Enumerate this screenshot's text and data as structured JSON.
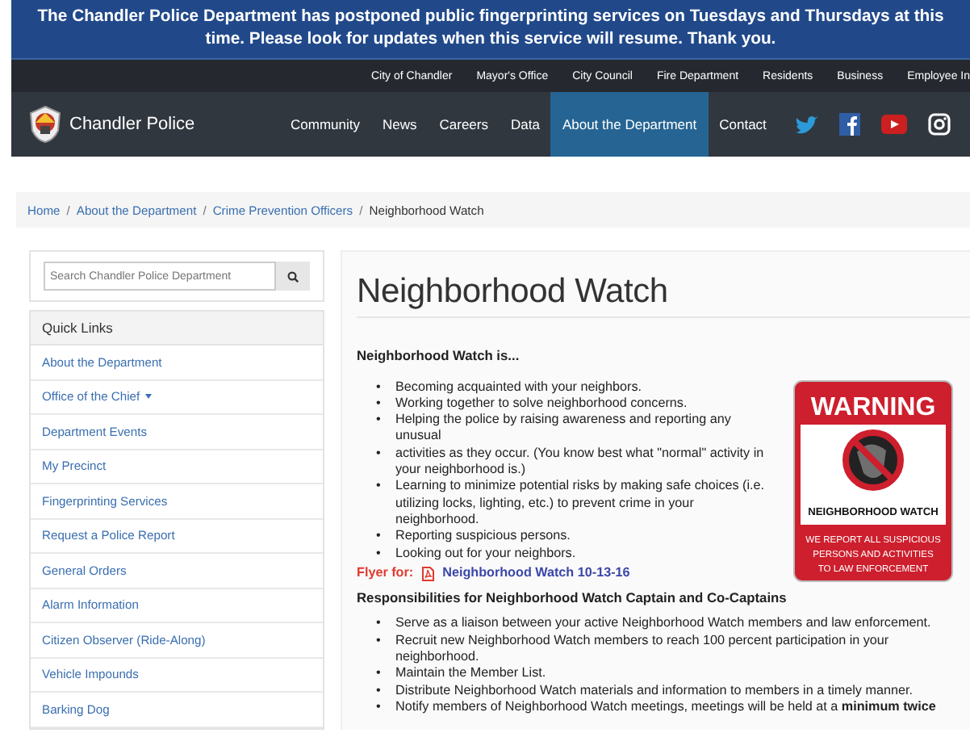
{
  "alert_banner": {
    "text": "The Chandler Police Department has postponed public fingerprinting services on Tuesdays and Thursdays at this time. Please look for updates when this service will resume. Thank you."
  },
  "utility_links": [
    "City of Chandler",
    "Mayor's Office",
    "City Council",
    "Fire Department",
    "Residents",
    "Business",
    "Employee In"
  ],
  "header": {
    "site_name": "Chandler Police",
    "nav": [
      {
        "label": "Community",
        "selected": false
      },
      {
        "label": "News",
        "selected": false
      },
      {
        "label": "Careers",
        "selected": false
      },
      {
        "label": "Data",
        "selected": false
      },
      {
        "label": "About the Department",
        "selected": true
      },
      {
        "label": "Contact",
        "selected": false
      }
    ],
    "social": [
      {
        "kind": "twitter"
      },
      {
        "kind": "facebook"
      },
      {
        "kind": "youtube"
      },
      {
        "kind": "instagram"
      }
    ]
  },
  "breadcrumb": {
    "links": [
      {
        "label": "Home",
        "separator": "/"
      },
      {
        "label": "About the Department",
        "separator": "/"
      },
      {
        "label": "Crime Prevention Officers",
        "separator": "/"
      }
    ],
    "current": "Neighborhood Watch"
  },
  "sidebar": {
    "search": {
      "placeholder": "Search Chandler Police Department"
    },
    "heading": "Quick Links",
    "items": [
      {
        "label": "About the Department",
        "has_menu": false
      },
      {
        "label": "Office of the Chief",
        "has_menu": true
      },
      {
        "label": "Department Events",
        "has_menu": false
      },
      {
        "label": "My Precinct",
        "has_menu": false
      },
      {
        "label": "Fingerprinting Services",
        "has_menu": false
      },
      {
        "label": "Request a Police Report",
        "has_menu": false
      },
      {
        "label": "General Orders",
        "has_menu": false
      },
      {
        "label": "Alarm Information",
        "has_menu": false
      },
      {
        "label": "Citizen Observer (Ride-Along)",
        "has_menu": false
      },
      {
        "label": "Vehicle Impounds",
        "has_menu": false
      },
      {
        "label": "Barking Dog",
        "has_menu": false
      }
    ]
  },
  "article": {
    "title": "Neighborhood Watch",
    "intro_heading": "Neighborhood Watch is...",
    "sign": {
      "heading": "WARNING",
      "name": "NEIGHBORHOOD WATCH",
      "lines": [
        "WE REPORT ALL SUSPICIOUS",
        "PERSONS AND ACTIVITIES",
        "TO LAW ENFORCEMENT"
      ]
    },
    "list_marker": "•",
    "intro_items": [
      "Becoming acquainted with your neighbors.",
      "Working together to solve neighborhood concerns.",
      "Helping the police by raising awareness and reporting any unusual",
      "activities as they occur. (You know best what \"normal\" activity in your neighborhood is.)",
      "Learning to minimize potential risks by making safe choices (i.e. utilizing locks, lighting, etc.) to prevent crime in your neighborhood.",
      "Reporting suspicious persons.",
      "Looking out for your neighbors."
    ],
    "flyer": {
      "label": "Flyer for:",
      "link": "Neighborhood Watch 10-13-16"
    },
    "duties_heading": "Responsibilities for Neighborhood Watch Captain and Co-Captains",
    "duties": [
      "Serve as a liaison between your active Neighborhood Watch members and law enforcement.",
      "Recruit new Neighborhood Watch members to reach 100 percent participation in your neighborhood.",
      "Maintain the Member List.",
      "Distribute Neighborhood Watch materials and information to members in a timely manner.",
      "Notify members of Neighborhood Watch meetings, meetings will be held at a **minimum twice**"
    ]
  }
}
